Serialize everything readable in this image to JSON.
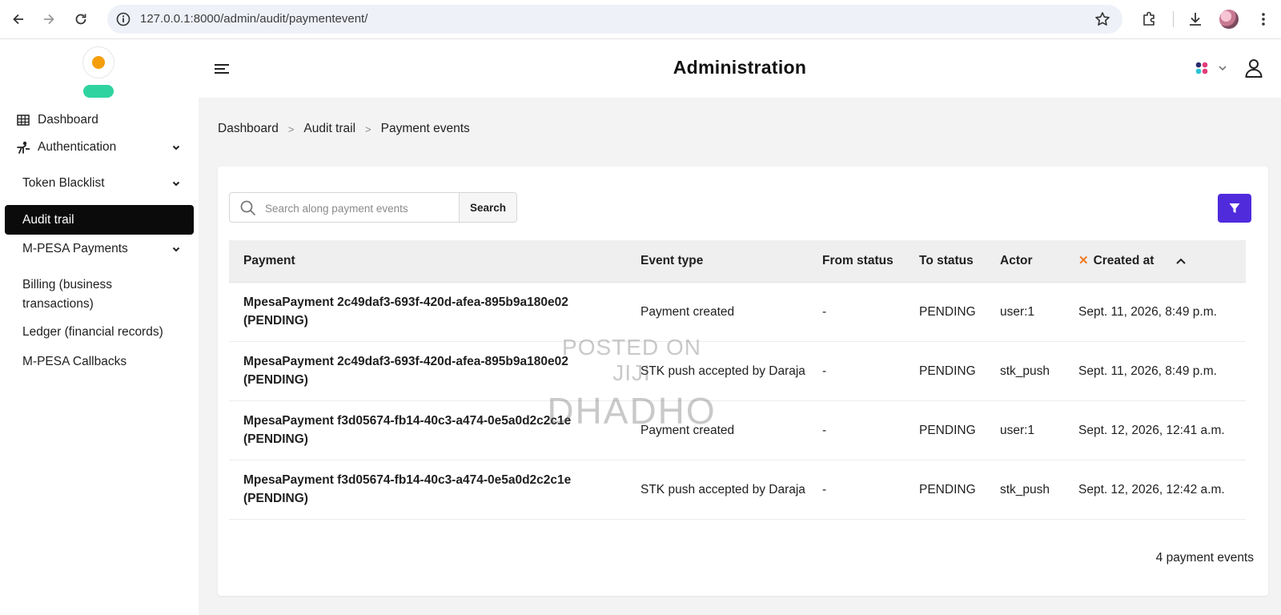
{
  "browser": {
    "url": "127.0.0.1:8000/admin/audit/paymentevent/"
  },
  "header": {
    "title": "Administration"
  },
  "sidebar": {
    "items": [
      {
        "label": "Dashboard"
      },
      {
        "label": "Authentication"
      },
      {
        "label": "Token Blacklist"
      },
      {
        "label": "Audit trail"
      },
      {
        "label": "M-PESA Payments"
      },
      {
        "label": "Billing (business transactions)"
      },
      {
        "label": "Ledger (financial records)"
      },
      {
        "label": "M-PESA Callbacks"
      }
    ]
  },
  "breadcrumb": [
    "Dashboard",
    "Audit trail",
    "Payment events"
  ],
  "search": {
    "placeholder": "Search along payment events",
    "button_label": "Search"
  },
  "table": {
    "columns": [
      "Payment",
      "Event type",
      "From status",
      "To status",
      "Actor",
      "Created at"
    ],
    "sort_clear": "✕",
    "rows": [
      {
        "payment": "MpesaPayment 2c49daf3-693f-420d-afea-895b9a180e02 (PENDING)",
        "event_type": "Payment created",
        "from_status": "-",
        "to_status": "PENDING",
        "actor": "user:1",
        "created_at": "Sept. 11, 2026, 8:49 p.m."
      },
      {
        "payment": "MpesaPayment 2c49daf3-693f-420d-afea-895b9a180e02 (PENDING)",
        "event_type": "STK push accepted by Daraja",
        "from_status": "-",
        "to_status": "PENDING",
        "actor": "stk_push",
        "created_at": "Sept. 11, 2026, 8:49 p.m."
      },
      {
        "payment": "MpesaPayment f3d05674-fb14-40c3-a474-0e5a0d2c2c1e (PENDING)",
        "event_type": "Payment created",
        "from_status": "-",
        "to_status": "PENDING",
        "actor": "user:1",
        "created_at": "Sept. 12, 2026, 12:41 a.m."
      },
      {
        "payment": "MpesaPayment f3d05674-fb14-40c3-a474-0e5a0d2c2c1e (PENDING)",
        "event_type": "STK push accepted by Daraja",
        "from_status": "-",
        "to_status": "PENDING",
        "actor": "stk_push",
        "created_at": "Sept. 12, 2026, 12:42 a.m."
      }
    ]
  },
  "result_count": "4 payment events",
  "watermark": {
    "line1": "POSTED ON JIJI",
    "line2": "DHADHO"
  },
  "colors": {
    "active_nav_bg": "#0b0b0b",
    "filter_button": "#4f2bdc",
    "sort_clear": "#f07a20",
    "logo_dot": "#f59e0b",
    "logo_pill": "#2fd3a0"
  }
}
